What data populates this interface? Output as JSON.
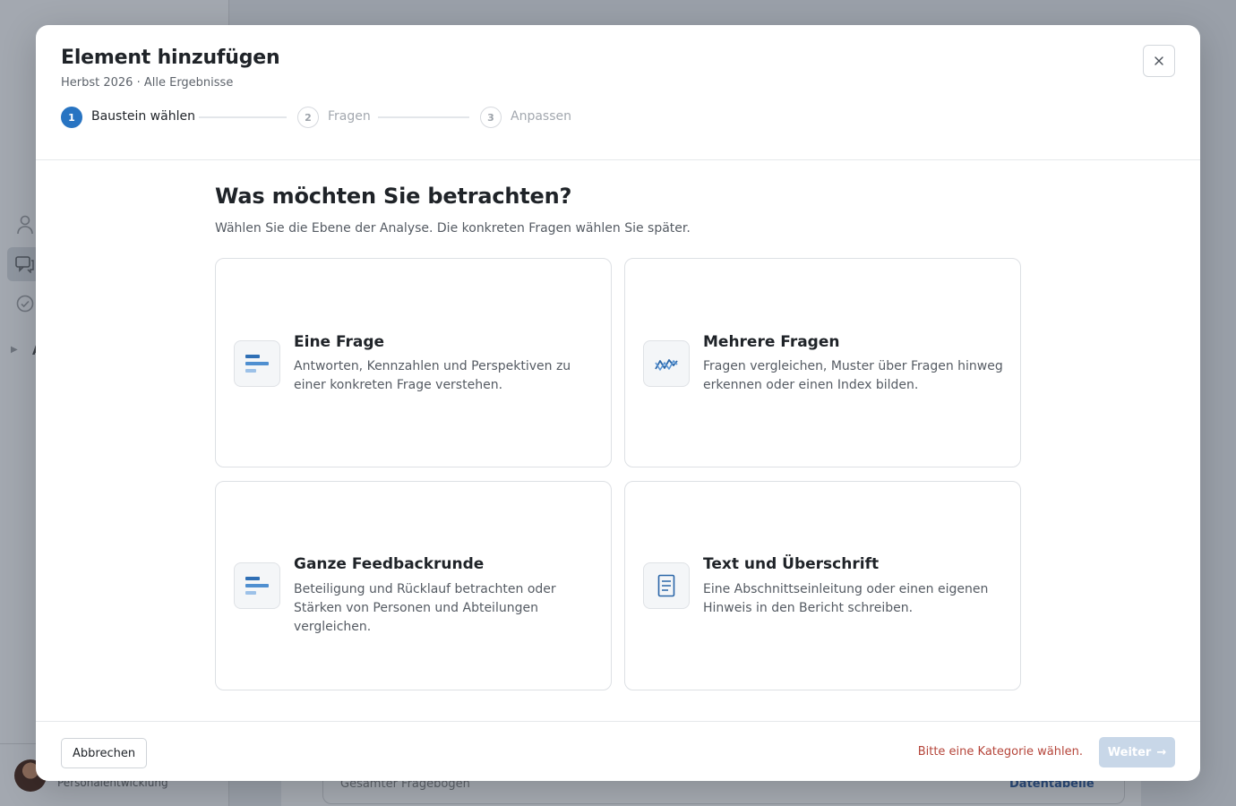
{
  "background": {
    "user_role": "Personalentwicklung",
    "card_text": "Gesamter Fragebogen",
    "card_link": "Datentabelle",
    "collapsed_letter": "A"
  },
  "modal": {
    "title": "Element hinzufügen",
    "subtitle": "Herbst 2026 · Alle Ergebnisse",
    "close_icon": "close-icon",
    "steps": [
      {
        "number": "1",
        "label": "Baustein wählen",
        "state": "active"
      },
      {
        "number": "2",
        "label": "Fragen",
        "state": "inactive"
      },
      {
        "number": "3",
        "label": "Anpassen",
        "state": "inactive"
      }
    ],
    "heading": "Was möchten Sie betrachten?",
    "description": "Wählen Sie die Ebene der Analyse. Die konkreten Fragen wählen Sie später.",
    "options": [
      {
        "icon": "bar-chart-icon",
        "title": "Eine Frage",
        "description": "Antworten, Kennzahlen und Perspektiven zu einer konkreten Frage verstehen."
      },
      {
        "icon": "multi-line-chart-icon",
        "title": "Mehrere Fragen",
        "description": "Fragen vergleichen, Muster über Fragen hinweg erkennen oder einen Index bilden."
      },
      {
        "icon": "bar-chart-icon",
        "title": "Ganze Feedbackrunde",
        "description": "Beteiligung und Rücklauf betrachten oder Stärken von Personen und Abteilungen vergleichen."
      },
      {
        "icon": "document-icon",
        "title": "Text und Überschrift",
        "description": "Eine Abschnittseinleitung oder einen eigenen Hinweis in den Bericht schreiben."
      }
    ],
    "footer": {
      "cancel_label": "Abbrechen",
      "hint": "Bitte eine Kategorie wählen.",
      "next_label": "Weiter",
      "next_arrow": "→"
    }
  },
  "colors": {
    "accent": "#2874c2",
    "hint": "#b5453a",
    "disabled_button": "#c8d7e8"
  }
}
